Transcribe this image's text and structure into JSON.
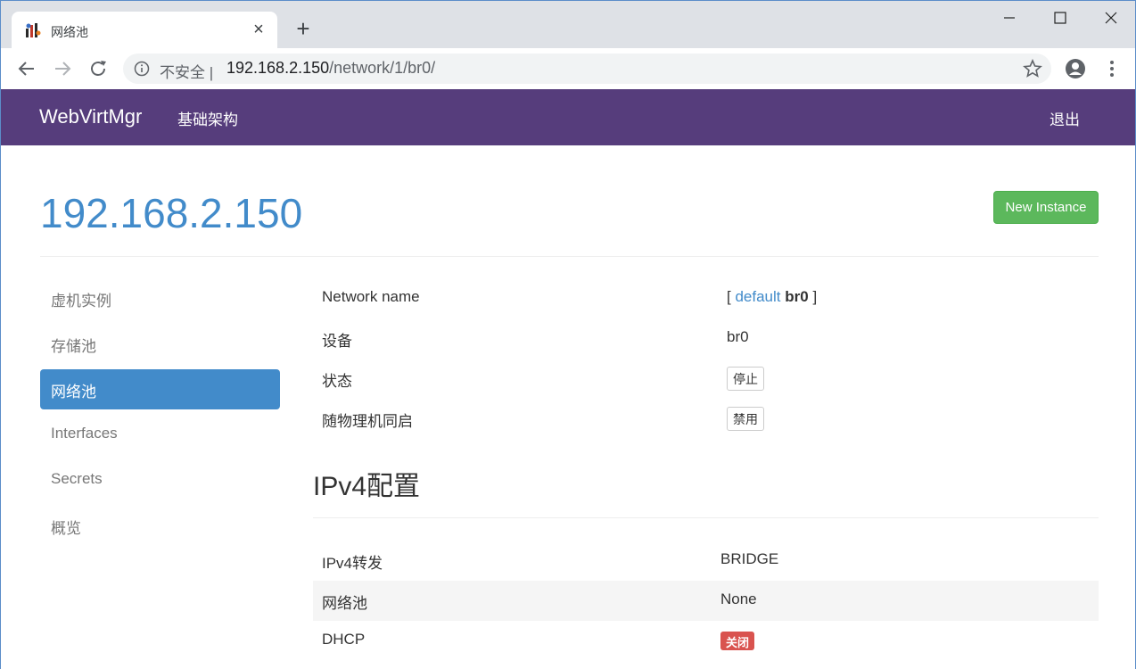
{
  "browser": {
    "tab_title": "网络池",
    "url_prefix": "不安全 |",
    "url_host": "192.168.2.150",
    "url_path": "/network/1/br0/"
  },
  "navbar": {
    "brand": "WebVirtMgr",
    "infra": "基础架构",
    "logout": "退出"
  },
  "header": {
    "title": "192.168.2.150",
    "new_instance": "New Instance"
  },
  "sidebar": {
    "items": [
      {
        "label": "虚机实例"
      },
      {
        "label": "存储池"
      },
      {
        "label": "网络池"
      },
      {
        "label": "Interfaces"
      },
      {
        "label": "Secrets"
      },
      {
        "label": "概览"
      }
    ]
  },
  "details": {
    "network_name_label": "Network name",
    "network_name_open": "[",
    "network_name_link": "default",
    "network_name_current": "br0",
    "network_name_close": "]",
    "device_label": "设备",
    "device_value": "br0",
    "state_label": "状态",
    "state_button": "停止",
    "autostart_label": "随物理机同启",
    "autostart_button": "禁用"
  },
  "ipv4": {
    "title": "IPv4配置",
    "rows": [
      {
        "label": "IPv4转发",
        "value": "BRIDGE"
      },
      {
        "label": "网络池",
        "value": "None"
      },
      {
        "label": "DHCP",
        "value": "关闭"
      }
    ]
  },
  "colors": {
    "navbar": "#563d7c",
    "primary": "#428bca",
    "success": "#5cb85c",
    "danger": "#d9534f"
  }
}
